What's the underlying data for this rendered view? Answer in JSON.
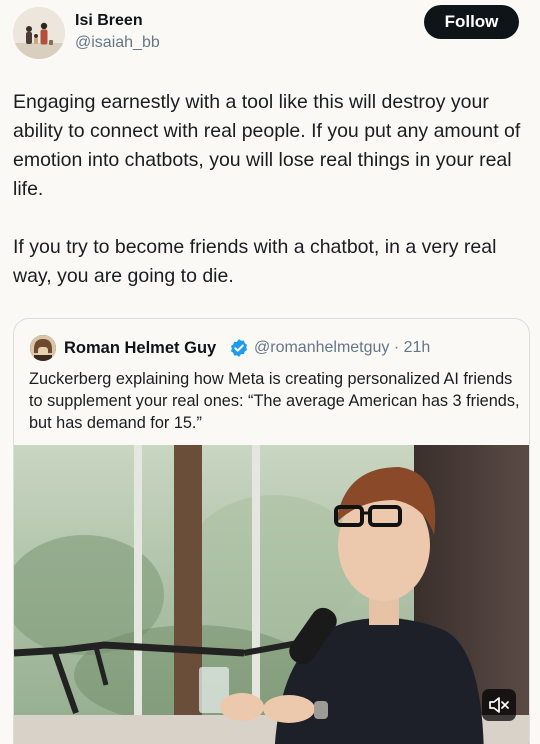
{
  "author": {
    "name": "Isi Breen",
    "handle": "@isaiah_bb",
    "avatar_icon": "family-photo-avatar"
  },
  "follow_label": "Follow",
  "tweet": {
    "paragraphs": [
      "Engaging earnestly with a tool like this will destroy your ability to connect with real people. If you put any amount of emotion into chatbots, you will lose real things in your real life.",
      "If you try to become friends with a chatbot, in a very real way, you are going to die."
    ]
  },
  "quoted_tweet": {
    "author_name": "Roman Helmet Guy",
    "verified_icon": "verified-badge-icon",
    "handle_time": "@romanhelmetguy · 21h",
    "text": "Zuckerberg explaining how Meta is creating personalized AI friends to supplement your real ones: “The average American has 3 friends, but has demand for 15.”",
    "media_icon": "video-thumbnail",
    "mute_icon": "mute-icon"
  },
  "colors": {
    "background": "#fbf9f6",
    "text": "#0f1419",
    "secondary_text": "#657786",
    "follow_bg": "#0f1419",
    "verified_blue": "#1d9bf0"
  }
}
